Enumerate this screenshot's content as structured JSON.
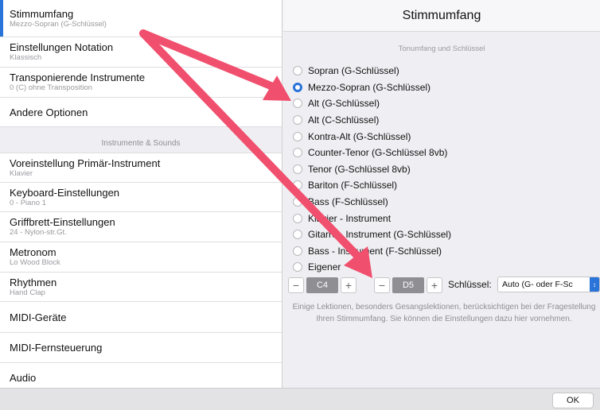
{
  "sidebar": {
    "items": [
      {
        "label": "Stimmumfang",
        "sub": "Mezzo-Sopran (G-Schlüssel)",
        "selected": true
      },
      {
        "label": "Einstellungen Notation",
        "sub": "Klassisch"
      },
      {
        "label": "Transponierende Instrumente",
        "sub": "0 (C) ohne Transposition"
      },
      {
        "label": "Andere Optionen",
        "sub": ""
      }
    ],
    "section_header": "Instrumente & Sounds",
    "items2": [
      {
        "label": "Voreinstellung Primär-Instrument",
        "sub": "Klavier"
      },
      {
        "label": "Keyboard-Einstellungen",
        "sub": "0 - Piano 1"
      },
      {
        "label": "Griffbrett-Einstellungen",
        "sub": "24 - Nylon-str.Gt."
      },
      {
        "label": "Metronom",
        "sub": "Lo Wood Block"
      },
      {
        "label": "Rhythmen",
        "sub": "Hand Clap"
      },
      {
        "label": "MIDI-Geräte",
        "sub": ""
      },
      {
        "label": "MIDI-Fernsteuerung",
        "sub": ""
      },
      {
        "label": "Audio",
        "sub": ""
      }
    ]
  },
  "panel": {
    "title": "Stimmumfang",
    "subtitle": "Tonumfang und Schlüssel",
    "options": [
      {
        "label": "Sopran (G-Schlüssel)",
        "checked": false
      },
      {
        "label": "Mezzo-Sopran (G-Schlüssel)",
        "checked": true
      },
      {
        "label": "Alt (G-Schlüssel)",
        "checked": false
      },
      {
        "label": "Alt (C-Schlüssel)",
        "checked": false
      },
      {
        "label": "Kontra-Alt (G-Schlüssel)",
        "checked": false
      },
      {
        "label": "Counter-Tenor (G-Schlüssel 8vb)",
        "checked": false
      },
      {
        "label": "Tenor (G-Schlüssel 8vb)",
        "checked": false
      },
      {
        "label": "Bariton (F-Schlüssel)",
        "checked": false
      },
      {
        "label": "Bass (F-Schlüssel)",
        "checked": false
      },
      {
        "label": "Klavier - Instrument",
        "checked": false
      },
      {
        "label": "Gitarre - Instrument (G-Schlüssel)",
        "checked": false
      },
      {
        "label": "Bass - Instrument (F-Schlüssel)",
        "checked": false
      },
      {
        "label": "Eigener",
        "checked": false
      }
    ],
    "low_note": "C4",
    "high_note": "D5",
    "minus": "−",
    "plus": "+",
    "clef_label": "Schlüssel:",
    "clef_value": "Auto (G- oder F-Sc",
    "help": "Einige Lektionen, besonders Gesangslektionen, berücksichtigen bei der Fragestellung Ihren Stimmumfang. Sie können die Einstellungen dazu hier vornehmen."
  },
  "footer": {
    "ok_label": "OK"
  },
  "colors": {
    "accent": "#2a73d9",
    "annotation_arrow": "#f0506e"
  }
}
